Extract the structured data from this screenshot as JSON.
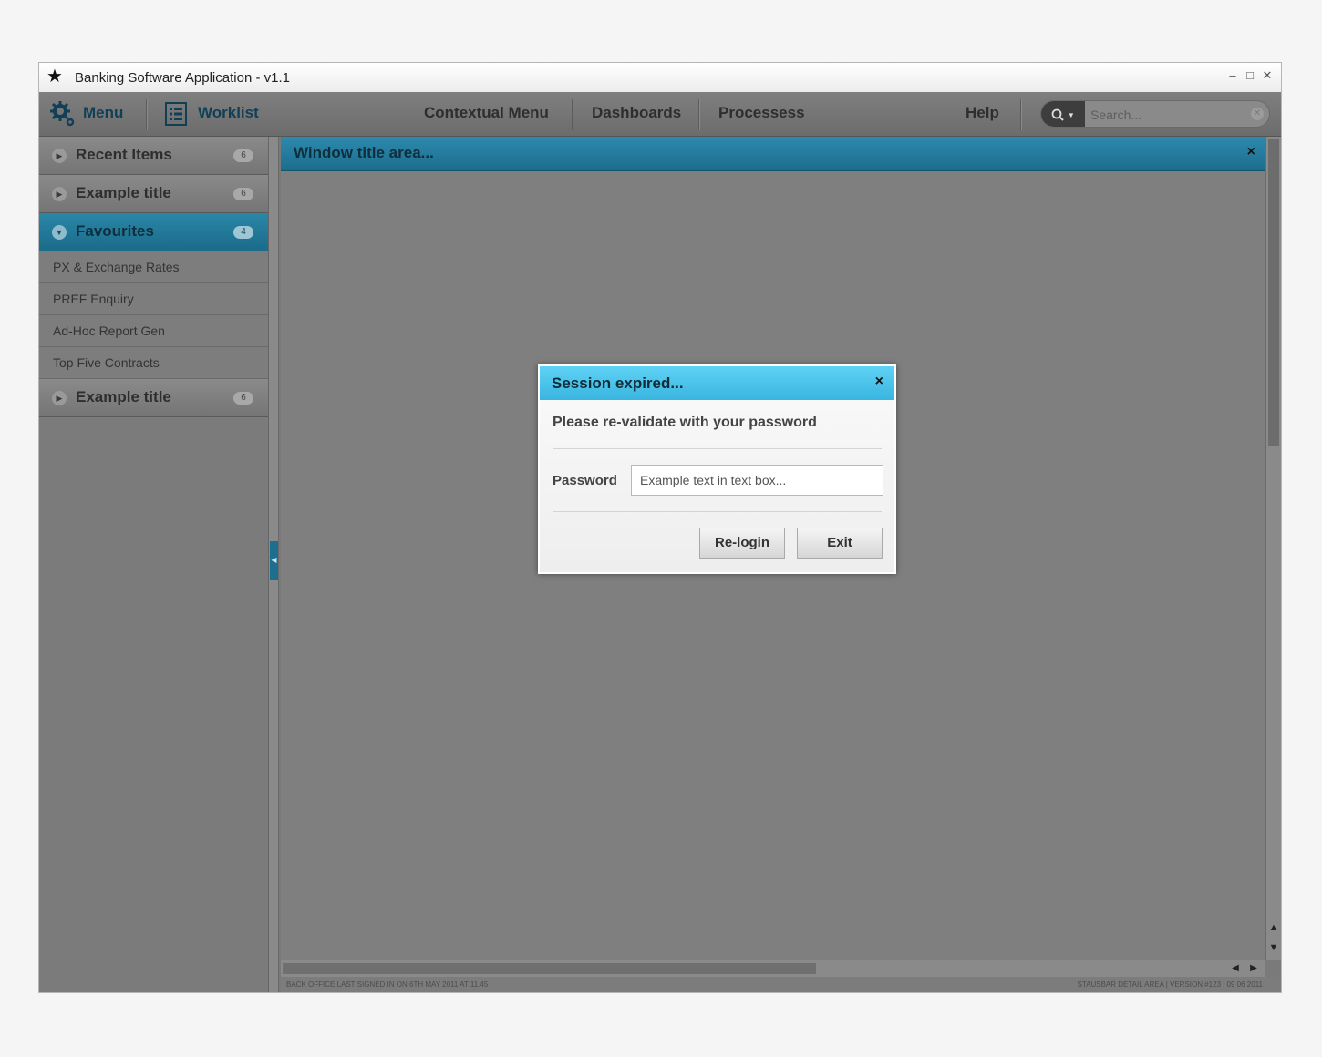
{
  "titlebar": {
    "star": "★",
    "title": "Banking Software Application - v1.1",
    "minimize": "–",
    "maximize": "□",
    "close": "✕"
  },
  "menubar": {
    "menu_label": "Menu",
    "worklist_label": "Worklist",
    "contextual_menu": "Contextual Menu",
    "dashboards": "Dashboards",
    "processes": "Processess",
    "help": "Help",
    "search_placeholder": "Search..."
  },
  "sidebar": {
    "sections": [
      {
        "label": "Recent Items",
        "count": "6"
      },
      {
        "label": "Example title",
        "count": "6"
      },
      {
        "label": "Favourites",
        "count": "4"
      },
      {
        "label": "Example title",
        "count": "6"
      }
    ],
    "favourites": [
      "PX & Exchange Rates",
      "PREF Enquiry",
      "Ad-Hoc Report Gen",
      "Top Five Contracts"
    ]
  },
  "main": {
    "window_title": "Window title area...",
    "close": "×"
  },
  "dialog": {
    "title": "Session expired...",
    "close": "×",
    "message": "Please re-validate with your password",
    "password_label": "Password",
    "password_placeholder": "Example text in text box...",
    "relogin": "Re-login",
    "exit": "Exit"
  },
  "statusbar": {
    "left": "BACK OFFICE LAST SIGNED IN ON 6TH MAY 2011 AT 11.45",
    "right": "STAUSBAR DETAIL AREA  |  VERSION  #123  |  09 06 2011"
  },
  "colors": {
    "accent_teal": "#1c6d8d",
    "dialog_header": "#3ab5e0",
    "background": "#7f7f7f"
  }
}
